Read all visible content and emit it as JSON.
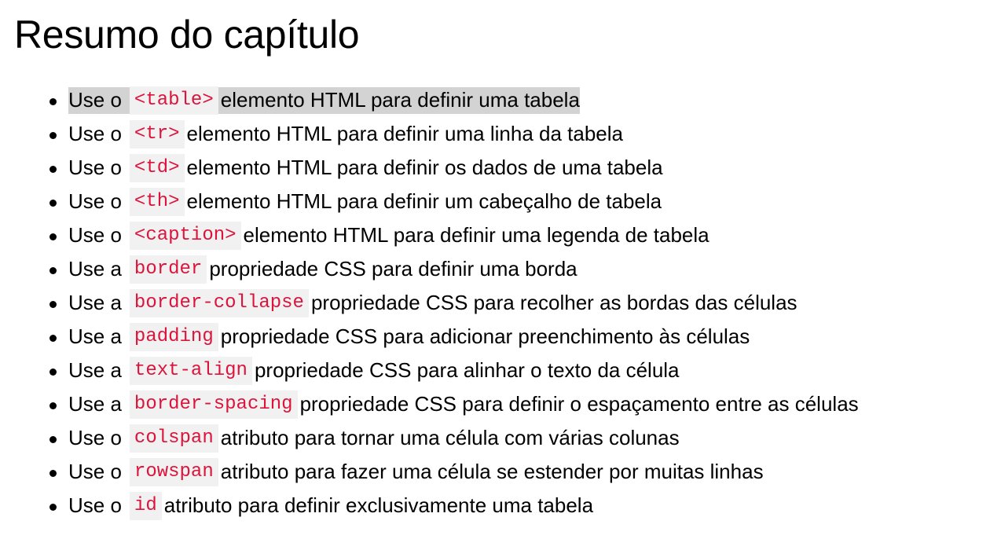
{
  "page": {
    "title": "Resumo do capítulo"
  },
  "colors": {
    "code_text": "#dc143c",
    "code_background": "#f1f1f1",
    "highlight_background": "#d3d3d3",
    "text": "#000000",
    "background": "#ffffff"
  },
  "items": [
    {
      "lead": "Use o",
      "code": "<table>",
      "text": "elemento HTML para definir uma tabela",
      "highlighted": true
    },
    {
      "lead": "Use o",
      "code": "<tr>",
      "text": "elemento HTML para definir uma linha da tabela",
      "highlighted": false
    },
    {
      "lead": "Use o",
      "code": "<td>",
      "text": "elemento HTML para definir os dados de uma tabela",
      "highlighted": false
    },
    {
      "lead": "Use o",
      "code": "<th>",
      "text": "elemento HTML para definir um cabeçalho de tabela",
      "highlighted": false
    },
    {
      "lead": "Use o",
      "code": "<caption>",
      "text": "elemento HTML para definir uma legenda de tabela",
      "highlighted": false
    },
    {
      "lead": "Use a",
      "code": "border",
      "text": "propriedade CSS para definir uma borda",
      "highlighted": false
    },
    {
      "lead": "Use a",
      "code": "border-collapse",
      "text": "propriedade CSS para recolher as bordas das células",
      "highlighted": false
    },
    {
      "lead": "Use a",
      "code": "padding",
      "text": "propriedade CSS para adicionar preenchimento às células",
      "highlighted": false
    },
    {
      "lead": "Use a",
      "code": "text-align",
      "text": "propriedade CSS para alinhar o texto da célula",
      "highlighted": false
    },
    {
      "lead": "Use a",
      "code": "border-spacing",
      "text": "propriedade CSS para definir o espaçamento entre as células",
      "highlighted": false
    },
    {
      "lead": "Use o",
      "code": "colspan",
      "text": "atributo para tornar uma célula com várias colunas",
      "highlighted": false
    },
    {
      "lead": "Use o",
      "code": "rowspan",
      "text": "atributo para fazer uma célula se estender por muitas linhas",
      "highlighted": false
    },
    {
      "lead": "Use o",
      "code": "id",
      "text": "atributo para definir exclusivamente uma tabela",
      "highlighted": false
    }
  ]
}
